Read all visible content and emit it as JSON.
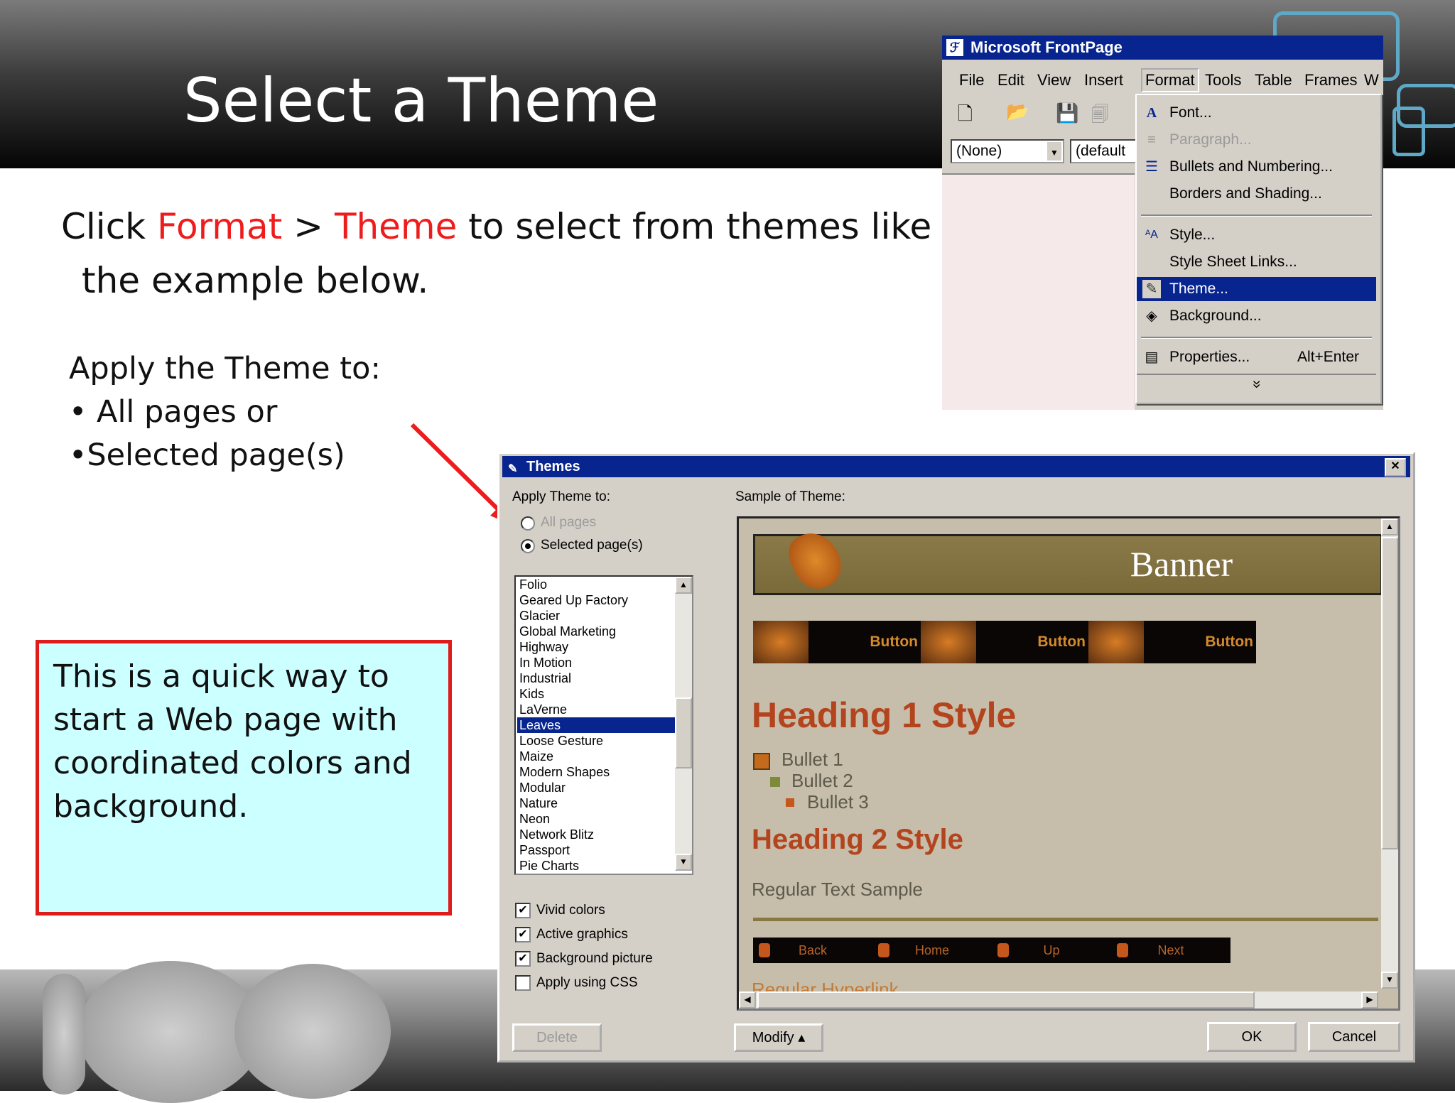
{
  "slide": {
    "title": "Select a Theme",
    "instruction": {
      "pre": "Click ",
      "format": "Format",
      "sep": " > ",
      "theme": "Theme",
      "post": " to select from themes like",
      "line2": "the example below."
    },
    "apply": {
      "heading": "Apply the Theme to:",
      "item1": "• All pages or",
      "item2": "•Selected page(s)"
    },
    "note": "This is a quick way to start a Web page with coordinated colors and background.",
    "colors": {
      "accent": "#ee1c1c",
      "note_bg": "#ccffff",
      "note_border": "#e01b1b"
    }
  },
  "frontpage": {
    "title": "Microsoft FrontPage",
    "menubar": [
      "File",
      "Edit",
      "View",
      "Insert",
      "Format",
      "Tools",
      "Table",
      "Frames",
      "W"
    ],
    "style_combo": "(None)",
    "font_combo": "(default",
    "format_menu": [
      {
        "label": "Font...",
        "icon": "font-icon",
        "glyph": "A"
      },
      {
        "label": "Paragraph...",
        "icon": "paragraph-icon",
        "glyph": "≡"
      },
      {
        "label": "Bullets and Numbering...",
        "icon": "bullets-icon",
        "glyph": "☰"
      },
      {
        "label": "Borders and Shading...",
        "icon": "",
        "glyph": ""
      },
      {
        "label": "Style...",
        "icon": "style-icon",
        "glyph": "ᴬA"
      },
      {
        "label": "Style Sheet Links...",
        "icon": "",
        "glyph": ""
      },
      {
        "label": "Theme...",
        "icon": "theme-icon",
        "glyph": "✎"
      },
      {
        "label": "Background...",
        "icon": "background-icon",
        "glyph": "◈"
      },
      {
        "label": "Properties...",
        "shortcut": "Alt+Enter",
        "icon": "properties-icon",
        "glyph": "▤"
      },
      {
        "label": "»",
        "icon": "expand-icon",
        "glyph": ""
      }
    ]
  },
  "themes_dialog": {
    "title": "Themes",
    "close": "✕",
    "apply_label": "Apply Theme to:",
    "radio_all": "All pages",
    "radio_selected": "Selected page(s)",
    "sample_label": "Sample of Theme:",
    "theme_list": [
      "Folio",
      "Geared Up Factory",
      "Glacier",
      "Global Marketing",
      "Highway",
      "In Motion",
      "Industrial",
      "Kids",
      "LaVerne",
      "Leaves",
      "Loose Gesture",
      "Maize",
      "Modern Shapes",
      "Modular",
      "Nature",
      "Neon",
      "Network Blitz",
      "Passport",
      "Pie Charts"
    ],
    "selected_theme": "Leaves",
    "checkboxes": {
      "vivid": {
        "label": "Vivid colors",
        "checked": "✔"
      },
      "active": {
        "label": "Active graphics",
        "checked": "✔"
      },
      "background": {
        "label": "Background picture",
        "checked": "✔"
      },
      "css": {
        "label": "Apply using CSS",
        "checked": ""
      }
    },
    "buttons": {
      "delete": "Delete",
      "modify": "Modify ▴",
      "ok": "OK",
      "cancel": "Cancel"
    },
    "sample": {
      "banner": "Banner",
      "button": "Button",
      "heading1": "Heading 1 Style",
      "bullets": [
        "Bullet 1",
        "Bullet 2",
        "Bullet 3"
      ],
      "heading2": "Heading 2 Style",
      "regular": "Regular Text Sample",
      "nav": [
        "Back",
        "Home",
        "Up",
        "Next"
      ],
      "hyperlink": "Regular Hyperlink"
    }
  }
}
